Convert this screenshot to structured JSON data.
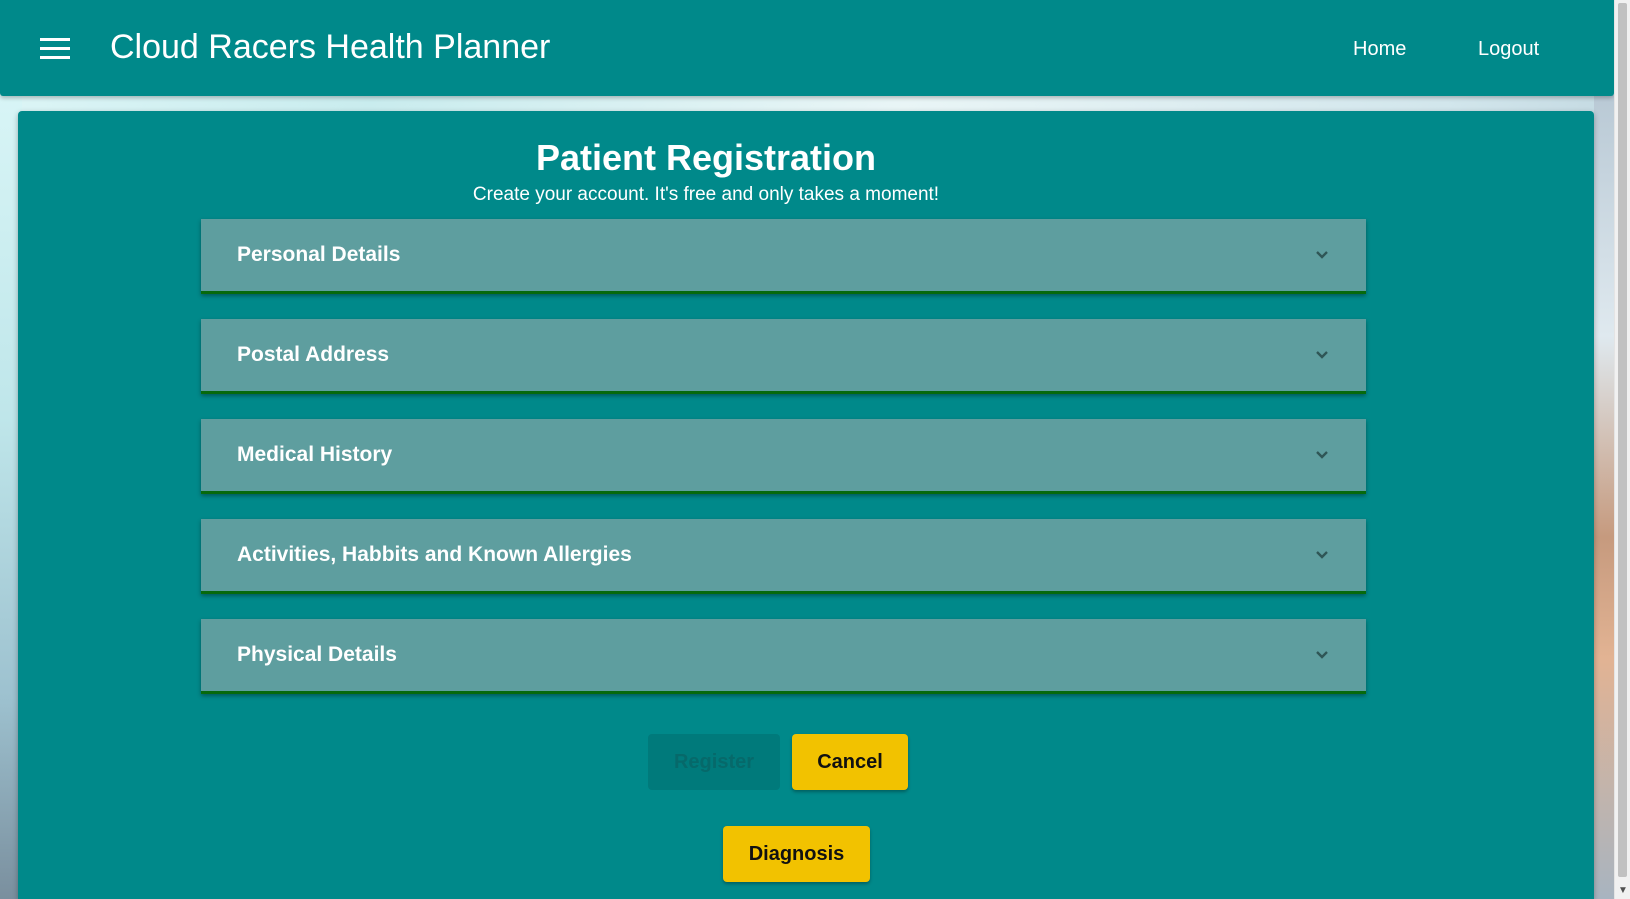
{
  "header": {
    "app_title": "Cloud Racers Health Planner",
    "nav": [
      {
        "label": "Home"
      },
      {
        "label": "Logout"
      }
    ]
  },
  "registration": {
    "title": "Patient Registration",
    "subtitle": "Create your account. It's free and only takes a moment!",
    "sections": [
      {
        "label": "Personal Details",
        "expanded": false
      },
      {
        "label": "Postal Address",
        "expanded": false
      },
      {
        "label": "Medical History",
        "expanded": false
      },
      {
        "label": "Activities, Habbits and Known Allergies",
        "expanded": false
      },
      {
        "label": "Physical Details",
        "expanded": false
      }
    ],
    "buttons": {
      "register": {
        "label": "Register",
        "disabled": true
      },
      "cancel": {
        "label": "Cancel"
      },
      "diagnosis": {
        "label": "Diagnosis"
      }
    }
  },
  "colors": {
    "primary": "#00898a",
    "panel": "#5e9e9f",
    "panel_border": "#06690c",
    "accent": "#f2c200"
  },
  "icons": {
    "menu": "hamburger-icon",
    "section_toggle": "chevron-down-icon"
  }
}
